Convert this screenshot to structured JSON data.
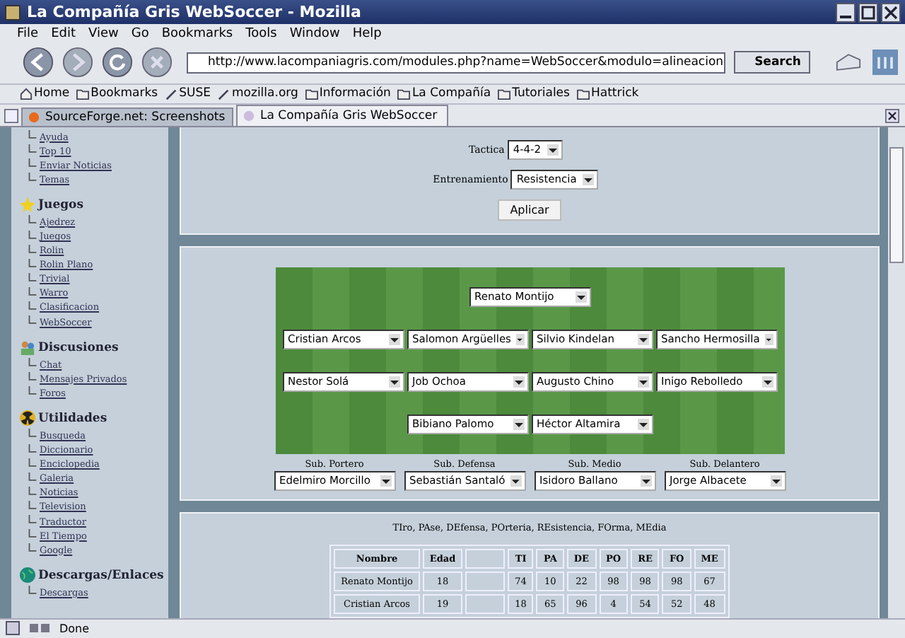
{
  "window": {
    "title": "La Compañía Gris WebSoccer - Mozilla"
  },
  "menu": [
    "File",
    "Edit",
    "View",
    "Go",
    "Bookmarks",
    "Tools",
    "Window",
    "Help"
  ],
  "address": {
    "value": "http://www.lacompaniagris.com/modules.php?name=WebSoccer&modulo=alineacion"
  },
  "search_button": "Search",
  "bookmarks": [
    {
      "label": "Home",
      "kind": "home"
    },
    {
      "label": "Bookmarks",
      "kind": "folder"
    },
    {
      "label": "SUSE",
      "kind": "link"
    },
    {
      "label": "mozilla.org",
      "kind": "link"
    },
    {
      "label": "Información",
      "kind": "folder"
    },
    {
      "label": "La Compañía",
      "kind": "folder"
    },
    {
      "label": "Tutoriales",
      "kind": "folder"
    },
    {
      "label": "Hattrick",
      "kind": "folder"
    }
  ],
  "tabs": [
    {
      "label": "SourceForge.net: Screenshots",
      "selected": false
    },
    {
      "label": "La Compañía Gris WebSoccer",
      "selected": true
    }
  ],
  "sidebar": [
    {
      "items": [
        "Ayuda",
        "Top 10",
        "Enviar Noticias",
        "Temas"
      ]
    },
    {
      "title": "Juegos",
      "kind": "star",
      "items": [
        "Ajedrez",
        "Juegos",
        "Rolin",
        "Rolin Plano",
        "Trivial",
        "Warro",
        "Clasificacion",
        "WebSoccer"
      ]
    },
    {
      "title": "Discusiones",
      "kind": "people",
      "items": [
        "Chat",
        "Mensajes Privados",
        "Foros"
      ]
    },
    {
      "title": "Utilidades",
      "kind": "radiation",
      "items": [
        "Busqueda",
        "Diccionario",
        "Enciclopedia",
        "Galeria",
        "Noticias",
        "Television",
        "Traductor",
        "El Tiempo",
        "Google"
      ]
    },
    {
      "title": "Descargas/Enlaces",
      "kind": "globe",
      "items": [
        "Descargas"
      ]
    }
  ],
  "form": {
    "fields": [
      {
        "label": "Tactica",
        "value": "4-4-2"
      },
      {
        "label": "Entrenamiento",
        "value": "Resistencia"
      }
    ],
    "button": "Aplicar"
  },
  "pitch": {
    "lines": [
      [
        "Renato Montijo"
      ],
      [
        "Cristian Arcos",
        "Salomon Argüelles",
        "Silvio Kindelan",
        "Sancho Hermosilla"
      ],
      [
        "Nestor Solá",
        "Job Ochoa",
        "Augusto Chino",
        "Inigo Rebolledo"
      ],
      [
        "Bibiano Palomo",
        "Héctor Altamira"
      ]
    ],
    "subs": [
      {
        "label": "Sub. Portero",
        "player": "Edelmiro Morcillo"
      },
      {
        "label": "Sub. Defensa",
        "player": "Sebastián Santaló"
      },
      {
        "label": "Sub. Medio",
        "player": "Isidoro Ballano"
      },
      {
        "label": "Sub. Delantero",
        "player": "Jorge Albacete"
      }
    ]
  },
  "legend": "TIro, PAse, DEfensa, POrteria, REsistencia, FOrma, MEdia",
  "table": {
    "columns": [
      "Nombre",
      "Edad",
      "TI",
      "PA",
      "DE",
      "PO",
      "RE",
      "FO",
      "ME"
    ],
    "rows": [
      [
        "Renato Montijo",
        "18",
        "74",
        "10",
        "22",
        "98",
        "98",
        "98",
        "67"
      ],
      [
        "Cristian Arcos",
        "19",
        "18",
        "65",
        "96",
        "4",
        "54",
        "52",
        "48"
      ]
    ]
  },
  "status_bar": {
    "text": "Done"
  }
}
